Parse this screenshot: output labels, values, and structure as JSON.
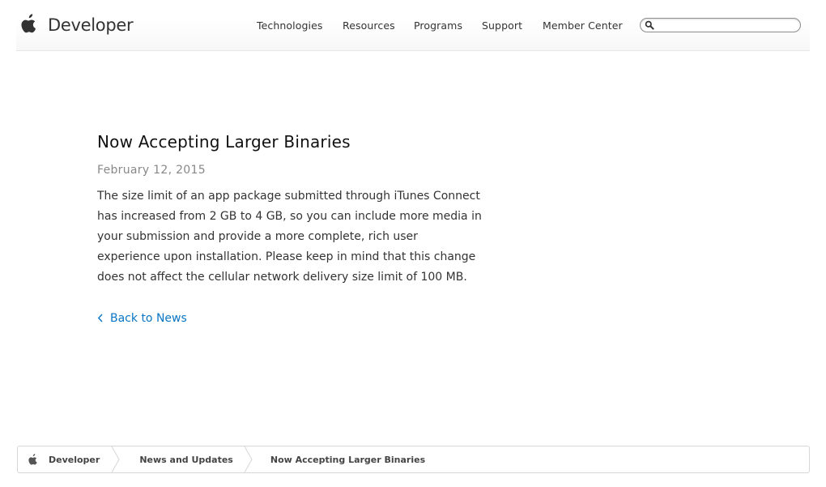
{
  "header": {
    "brand_label": "Developer",
    "nav": [
      {
        "label": "Technologies"
      },
      {
        "label": "Resources"
      },
      {
        "label": "Programs"
      },
      {
        "label": "Support"
      },
      {
        "label": "Member Center"
      }
    ],
    "search": {
      "value": "",
      "placeholder": ""
    }
  },
  "article": {
    "title": "Now Accepting Larger Binaries",
    "date": "February 12, 2015",
    "body": "The size limit of an app package submitted through iTunes Connect has increased from 2 GB to 4 GB, so you can include more media in your submission and provide a more complete, rich user experience upon installation. Please keep in mind that this change does not affect the cellular network delivery size limit of 100 MB.",
    "back_link": "Back to News"
  },
  "breadcrumb": {
    "items": [
      {
        "label": "Developer"
      },
      {
        "label": "News and Updates"
      },
      {
        "label": "Now Accepting Larger Binaries"
      }
    ]
  },
  "colors": {
    "link": "#0a76c4",
    "text": "#333333",
    "muted": "#888888"
  },
  "icons": {
    "brand": "apple-logo-icon",
    "search": "search-icon",
    "back": "chevron-left-icon",
    "breadcrumb_home": "apple-logo-icon",
    "breadcrumb_separator": "chevron-right-icon"
  }
}
